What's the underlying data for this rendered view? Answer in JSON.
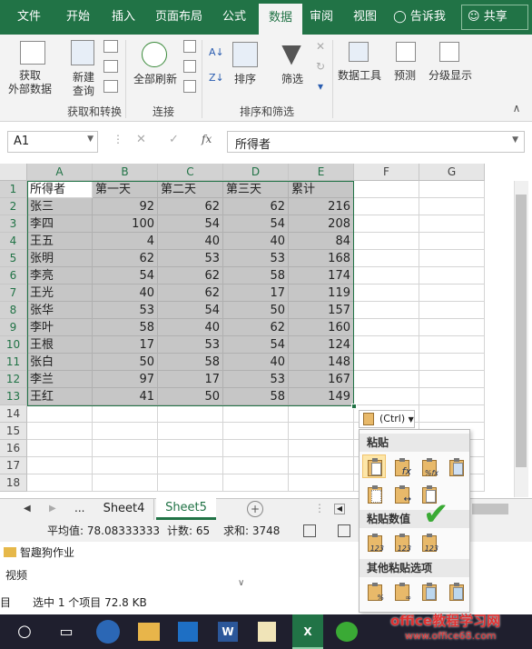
{
  "ribbon_tabs": [
    "文件",
    "开始",
    "插入",
    "页面布局",
    "公式",
    "数据",
    "审阅",
    "视图"
  ],
  "active_tab": "数据",
  "tell_me": "告诉我",
  "share": "共享",
  "ribbon": {
    "get_external": "获取\n外部数据",
    "new_query": "新建\n查询",
    "refresh_all": "全部刷新",
    "sort": "排序",
    "filter": "筛选",
    "data_tools": "数据工具",
    "forecast": "预测",
    "outline": "分级显示",
    "group_get_transform": "获取和转换",
    "group_connections": "连接",
    "group_sort_filter": "排序和筛选"
  },
  "name_box": "A1",
  "fx": "fx",
  "formula": "所得者",
  "columns": [
    "A",
    "B",
    "C",
    "D",
    "E",
    "F",
    "G"
  ],
  "rows": [
    "1",
    "2",
    "3",
    "4",
    "5",
    "6",
    "7",
    "8",
    "9",
    "10",
    "11",
    "12",
    "13",
    "14",
    "15",
    "16",
    "17",
    "18"
  ],
  "table": {
    "header": [
      "所得者",
      "第一天",
      "第二天",
      "第三天",
      "累计"
    ],
    "data": [
      [
        "张三",
        "92",
        "62",
        "62",
        "216"
      ],
      [
        "李四",
        "100",
        "54",
        "54",
        "208"
      ],
      [
        "王五",
        "4",
        "40",
        "40",
        "84"
      ],
      [
        "张明",
        "62",
        "53",
        "53",
        "168"
      ],
      [
        "李亮",
        "54",
        "62",
        "58",
        "174"
      ],
      [
        "王光",
        "40",
        "62",
        "17",
        "119"
      ],
      [
        "张华",
        "53",
        "54",
        "50",
        "157"
      ],
      [
        "李叶",
        "58",
        "40",
        "62",
        "160"
      ],
      [
        "王根",
        "17",
        "53",
        "54",
        "124"
      ],
      [
        "张白",
        "50",
        "58",
        "40",
        "148"
      ],
      [
        "李兰",
        "97",
        "17",
        "53",
        "167"
      ],
      [
        "王红",
        "41",
        "50",
        "58",
        "149"
      ]
    ]
  },
  "sheets": [
    "Sheet4",
    "Sheet5"
  ],
  "active_sheet": "Sheet5",
  "sheet_ellipsis": "...",
  "status": {
    "average": "平均值: 78.08333333",
    "count": "计数: 65",
    "sum": "求和: 3748"
  },
  "paste_button": "(Ctrl)",
  "paste_menu": {
    "paste": "粘贴",
    "paste_values": "粘贴数值",
    "other": "其他粘贴选项"
  },
  "explorer": {
    "folder1": "智趣狗作业",
    "folder2": "视频",
    "status": "选中 1 个项目  72.8 KB",
    "left_fragment": "目"
  },
  "watermark": {
    "line1": "office教程学习网",
    "line2": "www.office68.com"
  },
  "colors": {
    "excel_green": "#217346",
    "selection": "#c6c6c6",
    "checkmark": "#3aaa35"
  }
}
